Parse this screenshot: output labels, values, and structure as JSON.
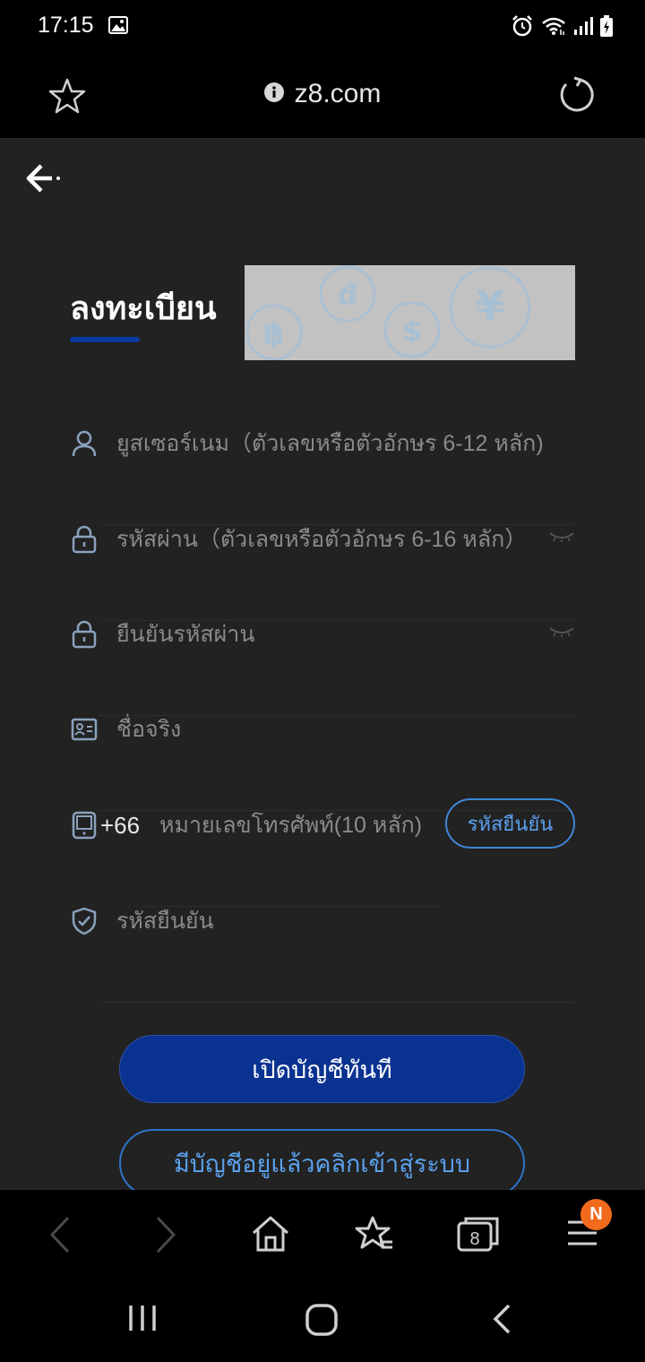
{
  "status": {
    "time": "17:15"
  },
  "browser": {
    "url": "z8.com",
    "tab_count": "8",
    "menu_badge": "N"
  },
  "page": {
    "title": "ลงทะเบียน",
    "fields": {
      "username_placeholder": "ยูสเซอร์เนม（ตัวเลขหรือตัวอักษร 6-12 หลัก)",
      "password_placeholder": "รหัสผ่าน（ตัวเลขหรือตัวอักษร 6-16 หลัก）",
      "confirm_password_placeholder": "ยืนยันรหัสผ่าน",
      "real_name_placeholder": "ชื่อจริง",
      "phone_prefix": "+66",
      "phone_placeholder": "หมายเลขโทรศัพท์(10 หลัก)",
      "otp_button": "รหัสยืนยัน",
      "otp_placeholder": "รหัสยืนยัน"
    },
    "buttons": {
      "open_account": "เปิดบัญชีทันที",
      "login": "มีบัญชีอยู่แล้วคลิกเข้าสู่ระบบ"
    }
  },
  "colors": {
    "page_bg": "#222222",
    "primary_button": "#0a3290",
    "accent_blue": "#3d86d6",
    "badge": "#f26a1b"
  }
}
